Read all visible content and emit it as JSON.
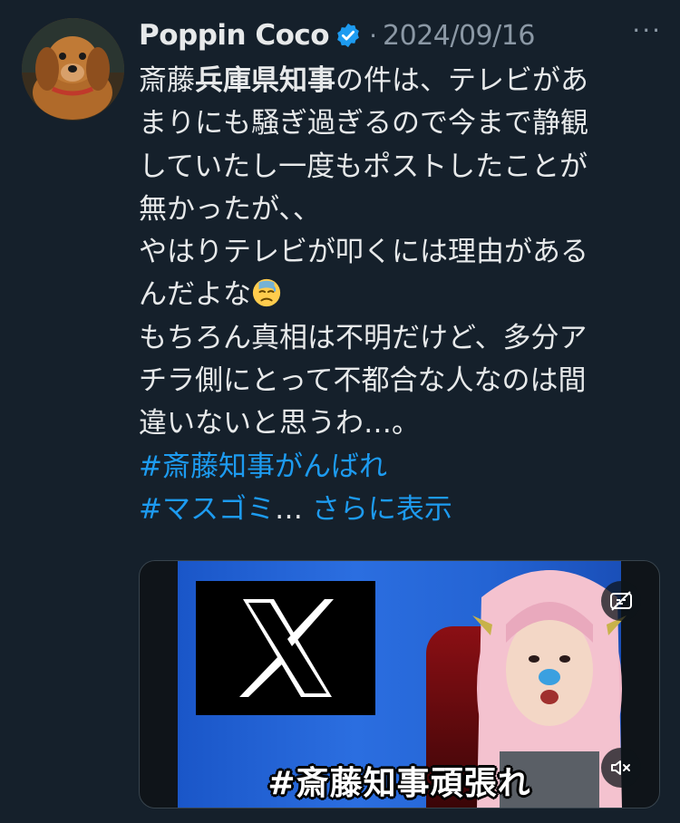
{
  "tweet": {
    "author": {
      "display_name": "Poppin Coco",
      "verified": true,
      "avatar_icon": "dog-avatar"
    },
    "separator": "·",
    "date": "2024/09/16",
    "more_label": "···",
    "lines": [
      {
        "parts": [
          {
            "text": "斎藤",
            "style": "normal"
          },
          {
            "text": "兵庫県知事",
            "style": "bold"
          },
          {
            "text": "の件は、テレビがあ",
            "style": "normal"
          }
        ]
      },
      {
        "parts": [
          {
            "text": "まりにも騒ぎ過ぎるので今まで静観",
            "style": "normal"
          }
        ]
      },
      {
        "parts": [
          {
            "text": "していたし一度もポストしたことが",
            "style": "normal"
          }
        ]
      },
      {
        "parts": [
          {
            "text": "無かったが、、",
            "style": "normal"
          }
        ]
      },
      {
        "parts": [
          {
            "text": "やはりテレビが叩くには理由がある",
            "style": "normal"
          }
        ]
      },
      {
        "parts": [
          {
            "text": "んだよな",
            "style": "normal"
          },
          {
            "emoji": "downcast-face-with-sweat-emoji"
          }
        ]
      },
      {
        "parts": [
          {
            "text": "もちろん真相は不明だけど、多分ア",
            "style": "normal"
          }
        ]
      },
      {
        "parts": [
          {
            "text": "チラ側にとって不都合な人なのは間",
            "style": "normal"
          }
        ]
      },
      {
        "parts": [
          {
            "text": "違いないと思うわ…。",
            "style": "normal"
          }
        ]
      },
      {
        "parts": [
          {
            "text": "#斎藤知事がんばれ",
            "style": "link"
          }
        ]
      },
      {
        "parts": [
          {
            "text": "#マスゴミ",
            "style": "link"
          },
          {
            "text": "… ",
            "style": "normal"
          },
          {
            "text": "さらに表示",
            "style": "link"
          }
        ]
      }
    ],
    "media": {
      "caption": "#斎藤知事頑張れ",
      "caption_toggle_icon": "captions-off-icon",
      "mute_icon": "volume-muted-icon"
    }
  },
  "colors": {
    "background": "#15202b",
    "text": "#e7e9ea",
    "secondary": "#8b98a5",
    "link": "#1d9bf0",
    "verified": "#1d9bf0"
  }
}
